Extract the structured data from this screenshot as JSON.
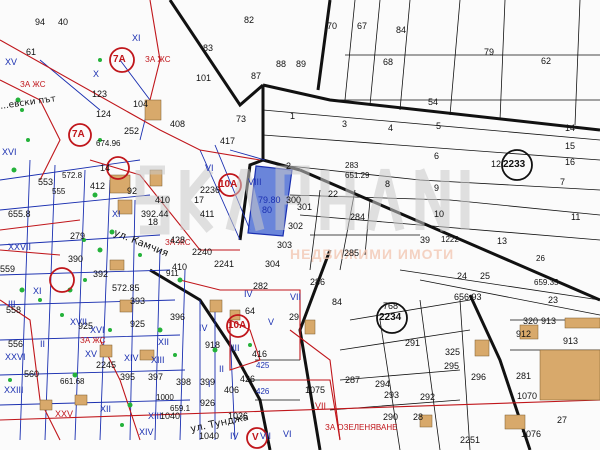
{
  "map": {
    "colors": {
      "background": "#fbfbfb",
      "parcel_line": "#1a1a1a",
      "boundary_red": "#c0161b",
      "block_blue": "#1a2fb0",
      "highlight_fill": "#5a78d6",
      "building": "#d8a96b",
      "green_dot": "#24b23a",
      "watermark": "#c9c9c9"
    },
    "highlight": {
      "label_top": "79.80",
      "label_bottom": "80"
    },
    "watermark_text": "НЕДВИЖИМИ ИМОТИ",
    "streets": [
      {
        "id": "kamchia",
        "text": "ул. Камчия"
      },
      {
        "id": "tuntsa",
        "text": "ул. Тунджа"
      },
      {
        "id": "devski",
        "text": "...евски път"
      }
    ],
    "circles": [
      {
        "id": "c7a-top",
        "text": "7А"
      },
      {
        "id": "c7a-mid",
        "text": "7А"
      },
      {
        "id": "c2233",
        "text": "2233"
      },
      {
        "id": "c2234",
        "text": "2234"
      },
      {
        "id": "c10a",
        "text": "10А"
      },
      {
        "id": "cV",
        "text": "V"
      },
      {
        "id": "c10a-top",
        "text": "10А"
      }
    ],
    "zones": [
      "ЗА ЖС",
      "ЗА ЖС",
      "ЗА ЖС",
      "ЗА ЖС",
      "ЗА ОЗЕЛЕНЯВАНЕ"
    ],
    "parcel_numbers": [
      "94",
      "40",
      "61",
      "82",
      "70",
      "67",
      "84",
      "83",
      "101",
      "87",
      "88",
      "89",
      "68",
      "79",
      "62",
      "104",
      "123",
      "124",
      "252",
      "674.96",
      "408",
      "73",
      "417",
      "54",
      "1",
      "3",
      "4",
      "5",
      "14",
      "15",
      "6",
      "16",
      "12",
      "2",
      "283",
      "651.29",
      "8",
      "7",
      "9",
      "10",
      "11",
      "92",
      "410",
      "2236",
      "22",
      "300",
      "301",
      "302",
      "303",
      "304",
      "284",
      "285",
      "286",
      "282",
      "13",
      "39",
      "1222",
      "24",
      "25",
      "26",
      "659.35",
      "656.93",
      "23",
      "768",
      "29",
      "84",
      "64",
      "320",
      "913",
      "913",
      "912",
      "325",
      "291",
      "295",
      "296",
      "281",
      "1070",
      "1075",
      "287",
      "294",
      "293",
      "292",
      "290",
      "28",
      "27",
      "1076",
      "2251",
      "279",
      "390",
      "392",
      "393",
      "395",
      "396",
      "397",
      "398",
      "399",
      "406",
      "426",
      "425",
      "426",
      "428",
      "2240",
      "2241",
      "416",
      "918",
      "926",
      "1040",
      "1036",
      "1040",
      "2245",
      "1000",
      "659.1",
      "661.68",
      "655.8",
      "559",
      "558",
      "556",
      "553",
      "560",
      "555",
      "572.8",
      "572.85",
      "925",
      "925",
      "911",
      "392.44",
      "410",
      "411",
      "412",
      "18",
      "14",
      "17",
      "15"
    ],
    "roman_numerals": [
      "XV",
      "XVI",
      "XI",
      "X",
      "VI",
      "VIII",
      "VII",
      "VII",
      "V",
      "IV",
      "III",
      "II",
      "I",
      "IV",
      "XIII",
      "XII",
      "XIV",
      "XVI",
      "XVII",
      "XXV",
      "XXVI",
      "XXVII",
      "XXIII",
      "XI",
      "XI",
      "VII",
      "VI",
      "IV",
      "XIII",
      "XIV",
      "XV",
      "XII",
      "III",
      "II"
    ]
  }
}
